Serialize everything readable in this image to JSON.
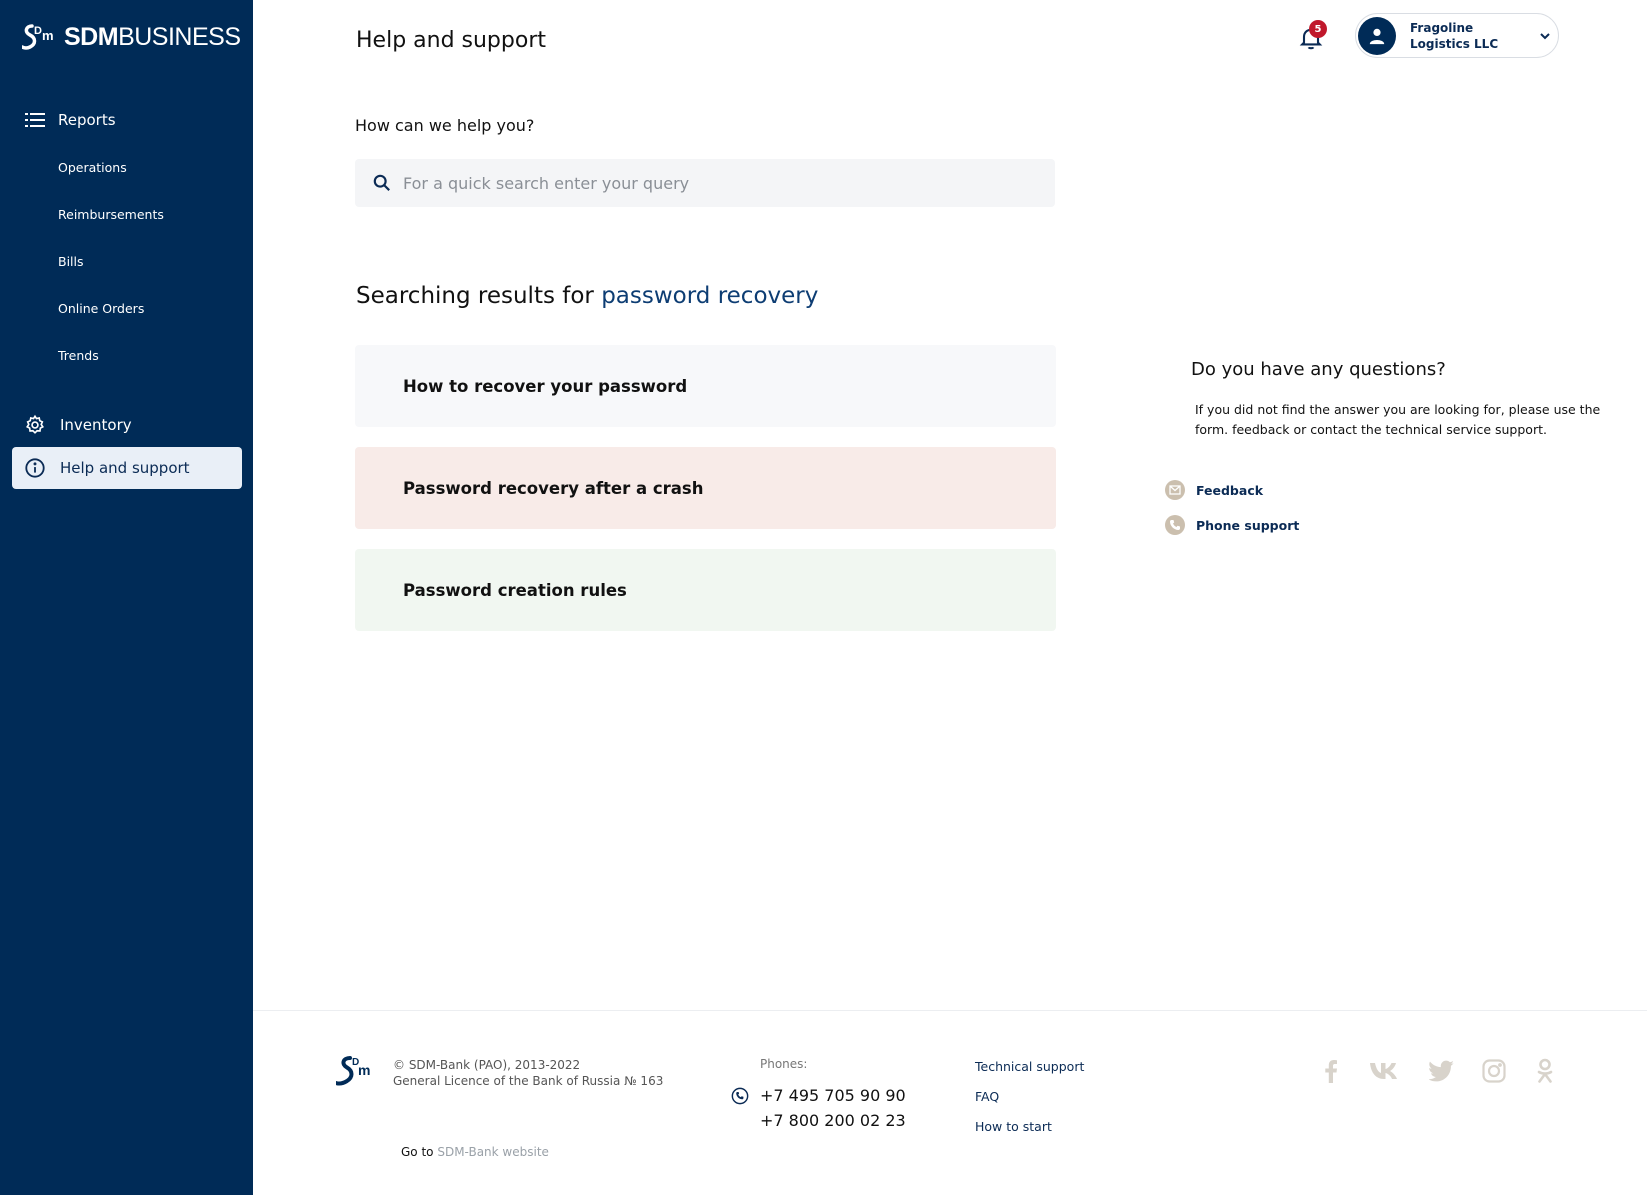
{
  "brand": {
    "logo_bold": "SDM",
    "logo_light": "BUSINESS"
  },
  "sidebar": {
    "reports_label": "Reports",
    "sub_items": [
      "Operations",
      "Reimbursements",
      "Bills",
      "Online Orders",
      "Trends"
    ],
    "inventory_label": "Inventory",
    "help_label": "Help and support"
  },
  "header": {
    "title": "Help and support",
    "notifications_count": "5",
    "account_name": "Fragoline Logistics LLC"
  },
  "search": {
    "question": "How can we help you?",
    "placeholder": "For a quick search enter your query"
  },
  "results": {
    "heading_prefix": "Searching results for",
    "query": "password recovery",
    "items": [
      {
        "label": "How to recover your password",
        "bg": "#f7f8fa"
      },
      {
        "label": "Password recovery after a crash",
        "bg": "#f8ebe8"
      },
      {
        "label": "Password creation rules",
        "bg": "#f1f7f1"
      }
    ]
  },
  "questions": {
    "title": "Do you have any questions?",
    "text": "If you did not find the answer you are looking for, please use the form. feedback or contact the technical service support.",
    "feedback_label": "Feedback",
    "phone_support_label": "Phone support"
  },
  "footer": {
    "copyright": "© SDM-Bank (PAO), 2013-2022",
    "licence": "General Licence of the Bank of Russia № 163",
    "goto_prefix": "Go to",
    "goto_link": "SDM-Bank website",
    "phones_label": "Phones:",
    "phones": [
      "+7 495 705 90 90",
      "+7 800 200 02 23"
    ],
    "links": [
      "Technical support",
      "FAQ",
      "How to start"
    ],
    "social": [
      "facebook-icon",
      "vk-icon",
      "twitter-icon",
      "instagram-icon",
      "odnoklassniki-icon"
    ]
  },
  "colors": {
    "sidebar_bg": "#002b57",
    "accent": "#0d3d73",
    "badge": "#c0182b",
    "social_icon": "#d8d3cb"
  }
}
